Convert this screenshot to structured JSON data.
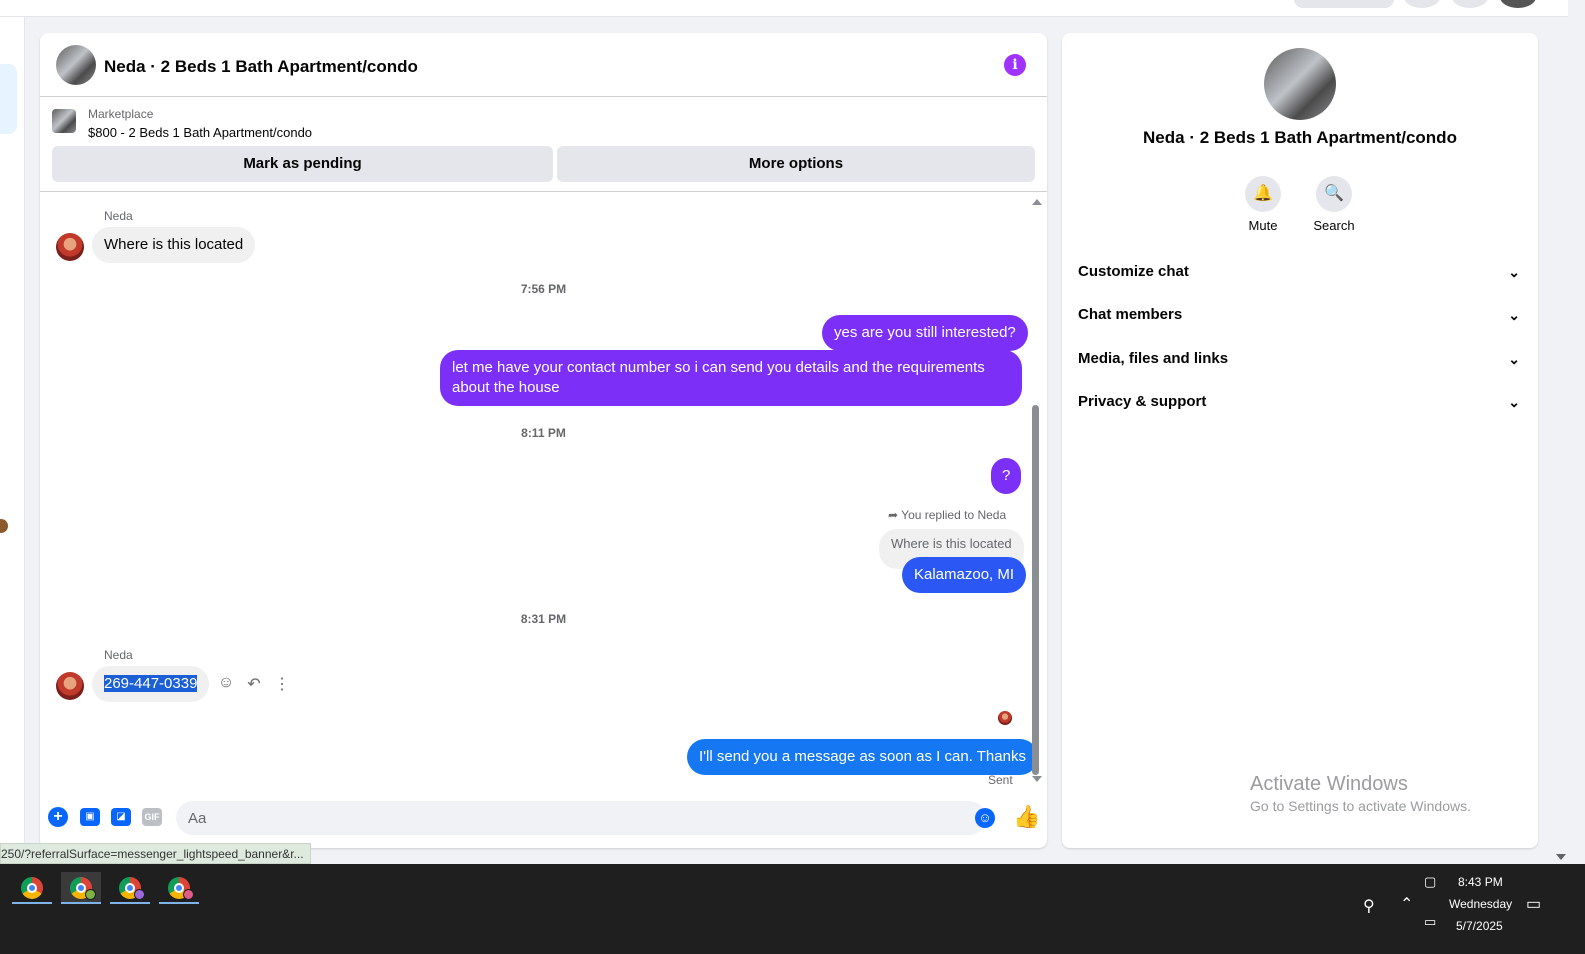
{
  "chat": {
    "title": "Neda · 2 Beds 1 Bath Apartment/condo",
    "marketplace": {
      "label": "Marketplace",
      "item": "$800 - 2 Beds 1 Bath Apartment/condo",
      "pending_button": "Mark as pending",
      "more_button": "More options"
    },
    "messages": {
      "sender1": "Neda",
      "msg1": "Where is this located",
      "ts1": "7:56 PM",
      "out1": "yes are you still interested?",
      "out2": "let me have your contact number so i can send you details and the requirements about the house",
      "ts2": "8:11 PM",
      "out3": "?",
      "replied_label": "You replied to Neda",
      "quoted": "Where is this located",
      "out4": "Kalamazoo, MI",
      "ts3": "8:31 PM",
      "sender2": "Neda",
      "msg2": "269-447-0339",
      "out5": "I'll send you a message as soon as I can. Thanks",
      "sent": "Sent"
    },
    "composer": {
      "placeholder": "Aa"
    }
  },
  "side": {
    "title": "Neda · 2 Beds 1 Bath Apartment/condo",
    "mute": "Mute",
    "search": "Search",
    "sections": [
      "Customize chat",
      "Chat members",
      "Media, files and links",
      "Privacy & support"
    ]
  },
  "watermark": {
    "line1": "Activate Windows",
    "line2": "Go to Settings to activate Windows."
  },
  "status_url": "250/?referralSurface=messenger_lightspeed_banner&r...",
  "taskbar": {
    "time": "8:43 PM",
    "day": "Wednesday",
    "date": "5/7/2025"
  },
  "colors": {
    "purple_bubble": "#7b2ff7",
    "blue_bubble": "#2b58f5",
    "accent": "#0866ff",
    "info": "#a033ff"
  },
  "icons": [
    "info-icon",
    "bell-icon",
    "search-icon",
    "chevron-down-icon",
    "plus-icon",
    "photo-icon",
    "sticker-icon",
    "gif-icon",
    "emoji-icon",
    "like-icon",
    "reply-icon",
    "more-icon"
  ]
}
